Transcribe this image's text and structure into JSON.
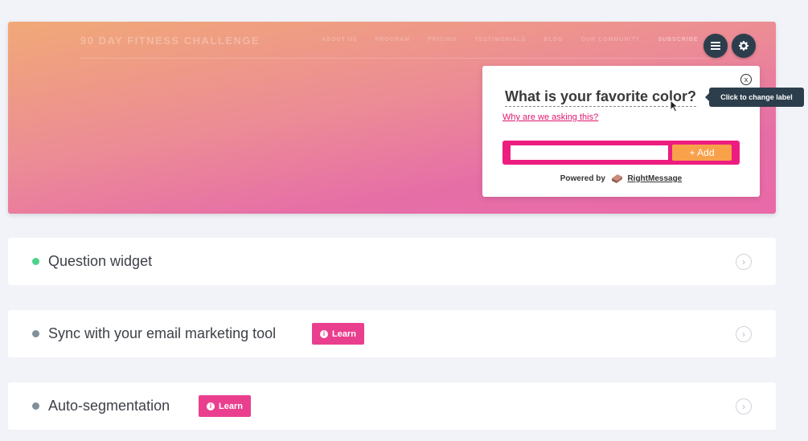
{
  "hero": {
    "brand": "90 DAY FITNESS CHALLENGE",
    "nav": [
      "ABOUT US",
      "PROGRAM",
      "PRICING",
      "TESTIMONIALS",
      "BLOG",
      "OUR COMMUNITY",
      "SUBSCRIBE"
    ]
  },
  "controls": {
    "menu_icon": "menu-icon",
    "settings_icon": "gear-icon"
  },
  "widget": {
    "question": "What is your favorite color?",
    "why_link": "Why are we asking this?",
    "input_value": "",
    "add_button": "+ Add",
    "powered_by": "Powered by",
    "brand_link": "RightMessage",
    "close": "x"
  },
  "tooltip": "Click to change label",
  "rows": [
    {
      "label": "Question widget",
      "status": "active",
      "learn": ""
    },
    {
      "label": "Sync with your email marketing tool",
      "status": "idle",
      "learn": "Learn"
    },
    {
      "label": "Auto-segmentation",
      "status": "idle",
      "learn": "Learn"
    }
  ],
  "colors": {
    "accent": "#ed1d80",
    "add": "#f9a14a",
    "active": "#4cd38b",
    "dark": "#2c3e4c"
  }
}
